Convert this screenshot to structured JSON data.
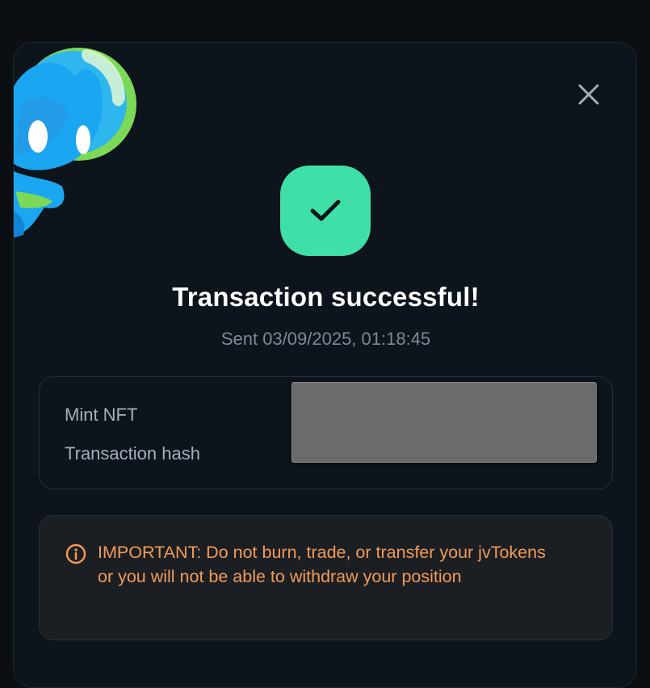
{
  "modal": {
    "title": "Transaction successful!",
    "sent_timestamp": "Sent 03/09/2025, 01:18:45",
    "close_icon": "close-icon",
    "status_icon": "check-icon"
  },
  "details": {
    "rows": [
      {
        "label": "Mint NFT"
      },
      {
        "label": "Transaction hash"
      }
    ]
  },
  "notice": {
    "icon": "info-icon",
    "text": "IMPORTANT: Do not burn, trade, or transfer your jvTokens or you will not be able to withdraw your position"
  },
  "colors": {
    "background": "#0b0f14",
    "modal_bg": "#0e141b",
    "success": "#3fe0a7",
    "warning_text": "#f39a55",
    "muted_text": "#7e8896"
  }
}
